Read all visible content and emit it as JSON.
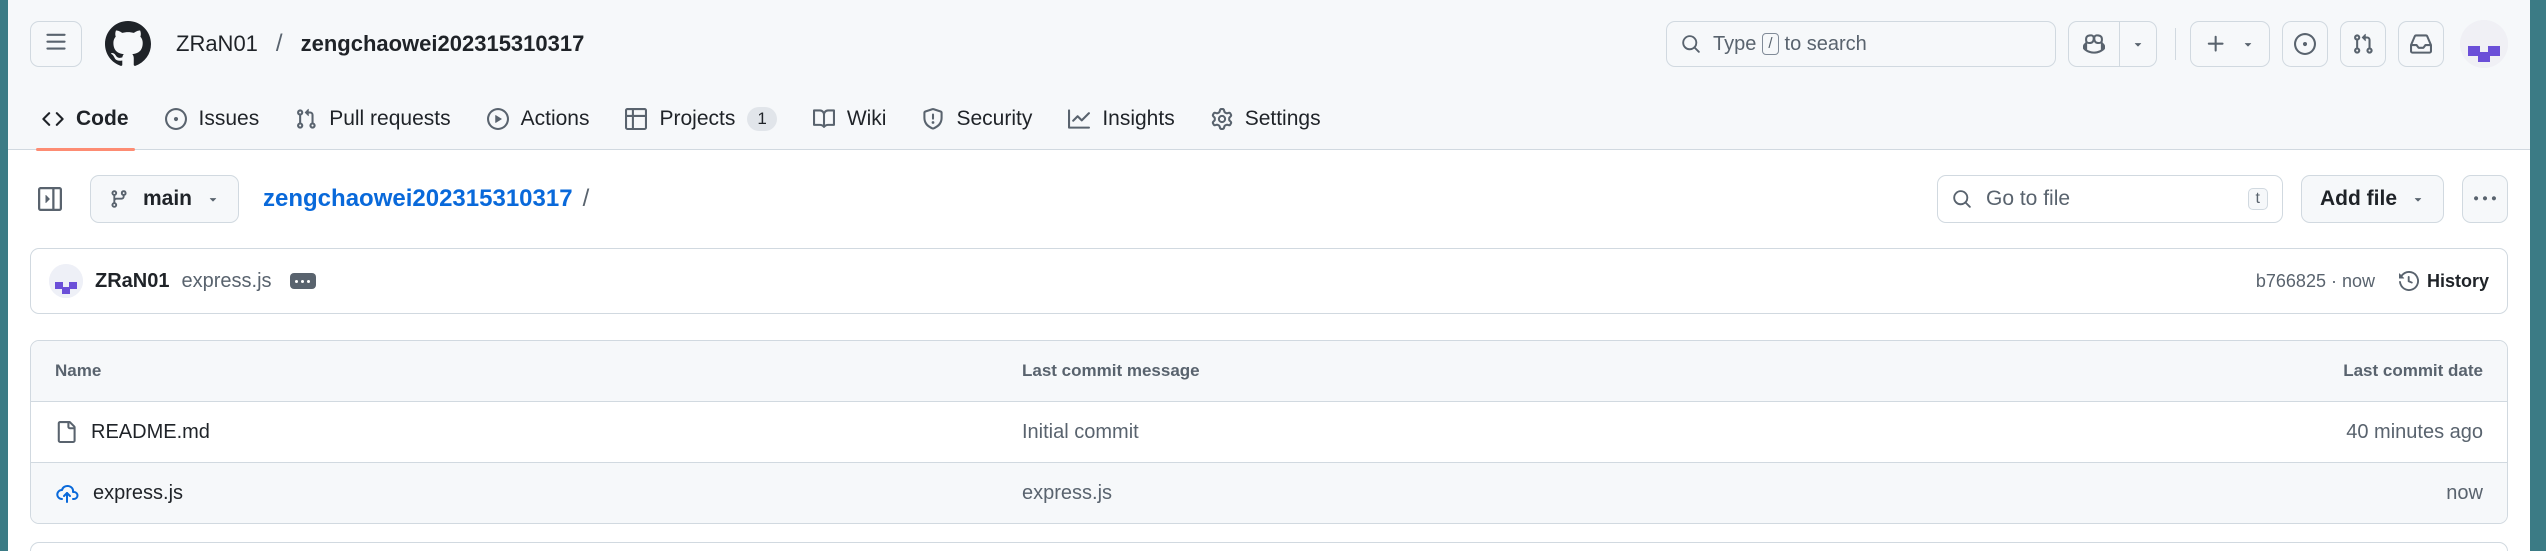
{
  "header": {
    "owner": "ZRaN01",
    "separator": "/",
    "repo": "zengchaowei202315310317",
    "search": {
      "prefix": "Type",
      "key": "/",
      "suffix": "to search"
    }
  },
  "tabs": [
    {
      "label": "Code",
      "icon": "code-icon",
      "active": true
    },
    {
      "label": "Issues",
      "icon": "issue-icon"
    },
    {
      "label": "Pull requests",
      "icon": "pull-request-icon"
    },
    {
      "label": "Actions",
      "icon": "play-icon"
    },
    {
      "label": "Projects",
      "icon": "table-icon",
      "counter": "1"
    },
    {
      "label": "Wiki",
      "icon": "book-icon"
    },
    {
      "label": "Security",
      "icon": "shield-icon"
    },
    {
      "label": "Insights",
      "icon": "graph-icon"
    },
    {
      "label": "Settings",
      "icon": "gear-icon"
    }
  ],
  "repobar": {
    "branch": "main",
    "path_repo": "zengchaowei202315310317",
    "path_sep": "/",
    "goto_placeholder": "Go to file",
    "goto_key": "t",
    "add_file": "Add file"
  },
  "commit": {
    "author": "ZRaN01",
    "message": "express.js",
    "meta": "b766825 · now",
    "history": "History"
  },
  "files": {
    "headers": {
      "name": "Name",
      "message": "Last commit message",
      "date": "Last commit date"
    },
    "rows": [
      {
        "name": "README.md",
        "icon": "file-icon",
        "message": "Initial commit",
        "date": "40 minutes ago"
      },
      {
        "name": "express.js",
        "icon": "cloud-upload-icon",
        "message": "express.js",
        "date": "now"
      }
    ]
  },
  "colors": {
    "accent": "#fd8c73",
    "link": "#0969da",
    "border": "#d1d9e0",
    "muted": "#59636e"
  }
}
